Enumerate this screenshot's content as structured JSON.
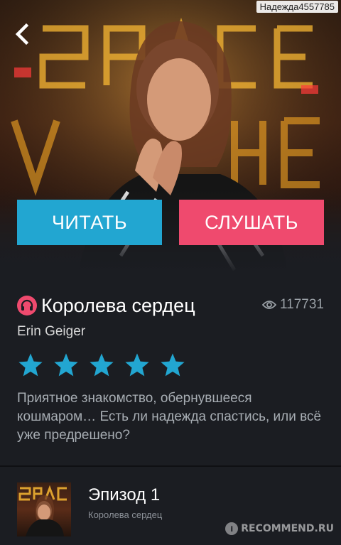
{
  "watermark_top": "Надежда4557785",
  "actions": {
    "read_label": "ЧИТАТЬ",
    "listen_label": "СЛУШАТЬ"
  },
  "story": {
    "title": "Королева сердец",
    "views": "117731",
    "author": "Erin Geiger",
    "rating": 5,
    "description": "Приятное знакомство, обернувшееся кошмаром… Есть ли надежда спастись, или всё уже предрешено?"
  },
  "episodes": [
    {
      "title": "Эпизод 1",
      "subtitle": "Королева сердец"
    }
  ],
  "hero_sign_text": "SPACE INVADE",
  "watermark_bottom": "RECOMMEND.RU",
  "colors": {
    "background": "#1b1d22",
    "read_button": "#22a6d1",
    "listen_button": "#ef4a6e",
    "star": "#22a6d1"
  },
  "icons": {
    "back": "chevron-left-icon",
    "audio": "headphones-icon",
    "views": "eye-icon",
    "star": "star-icon"
  }
}
